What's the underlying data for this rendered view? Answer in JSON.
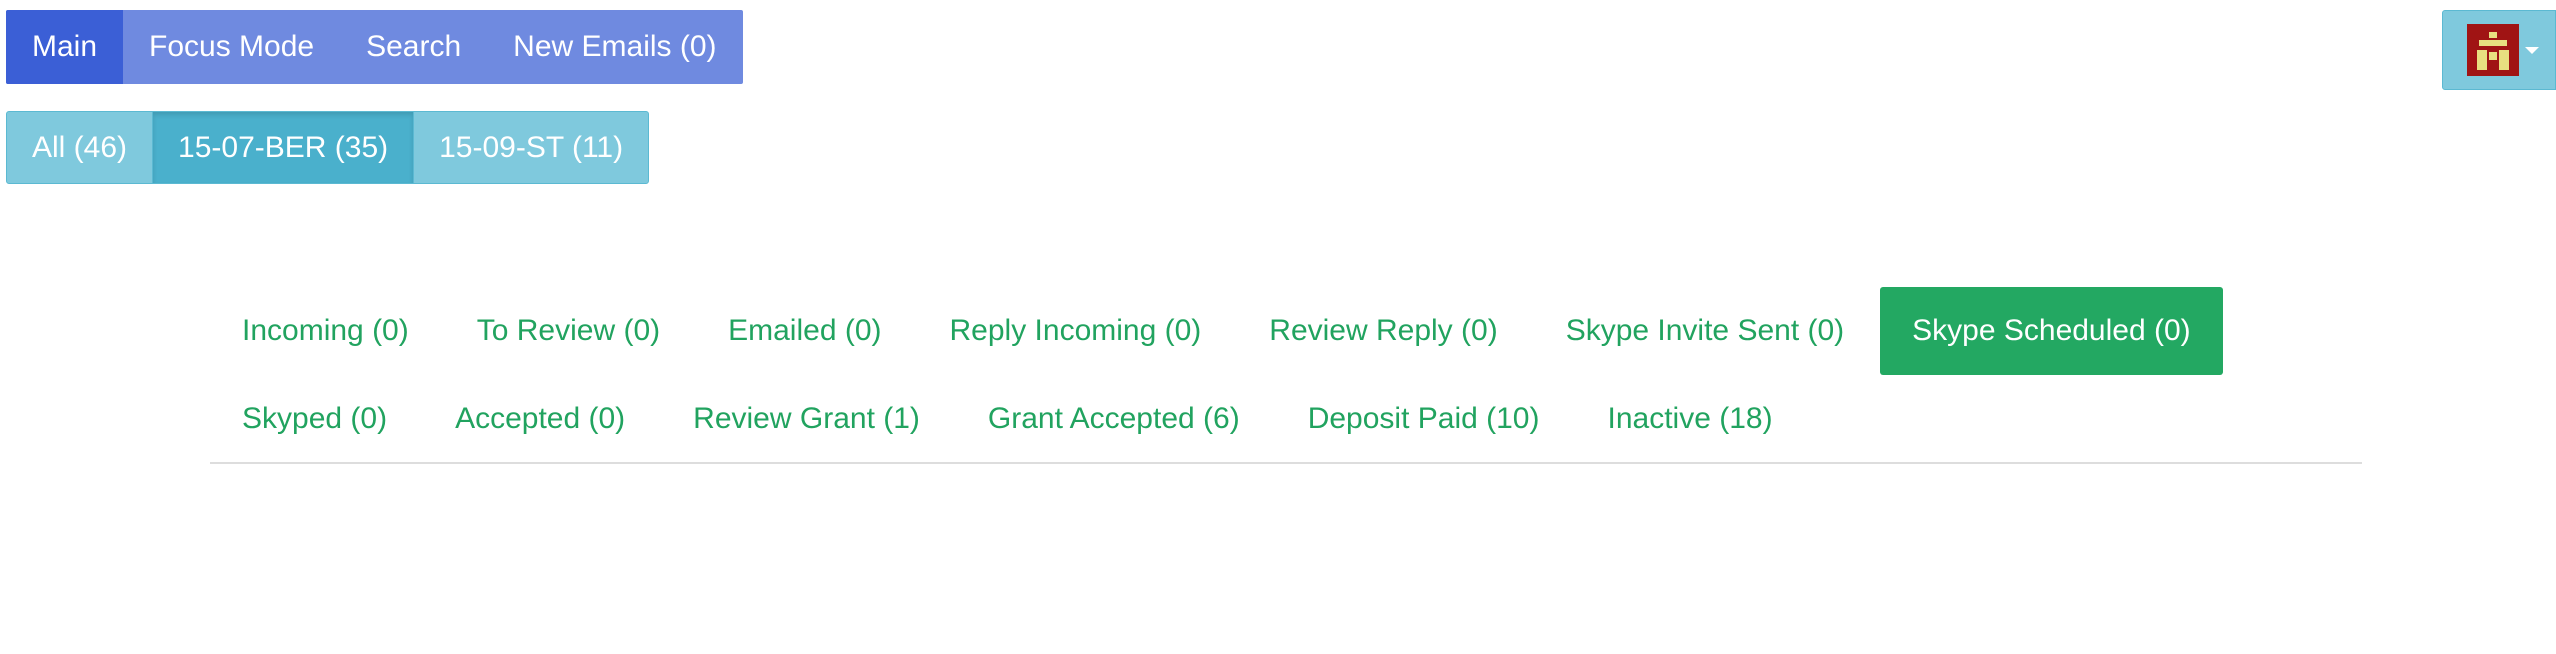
{
  "topnav": {
    "items": [
      {
        "label": "Main",
        "active": true
      },
      {
        "label": "Focus Mode",
        "active": false
      },
      {
        "label": "Search",
        "active": false
      },
      {
        "label": "New Emails (0)",
        "active": false
      }
    ]
  },
  "projects": {
    "items": [
      {
        "label": "All (46)",
        "active": false
      },
      {
        "label": "15-07-BER (35)",
        "active": true
      },
      {
        "label": "15-09-ST (11)",
        "active": false
      }
    ]
  },
  "user_menu": {
    "avatar_icon": "building-avatar-icon",
    "caret_icon": "caret-down-icon"
  },
  "status_tabs": {
    "row1": [
      {
        "label": "Incoming (0)",
        "active": false
      },
      {
        "label": "To Review (0)",
        "active": false
      },
      {
        "label": "Emailed (0)",
        "active": false
      },
      {
        "label": "Reply Incoming (0)",
        "active": false
      },
      {
        "label": "Review Reply (0)",
        "active": false
      },
      {
        "label": "Skype Invite Sent (0)",
        "active": false
      },
      {
        "label": "Skype Scheduled (0)",
        "active": true
      }
    ],
    "row2": [
      {
        "label": "Skyped (0)",
        "active": false
      },
      {
        "label": "Accepted (0)",
        "active": false
      },
      {
        "label": "Review Grant (1)",
        "active": false
      },
      {
        "label": "Grant Accepted (6)",
        "active": false
      },
      {
        "label": "Deposit Paid (10)",
        "active": false
      },
      {
        "label": "Inactive (18)",
        "active": false
      }
    ]
  },
  "colors": {
    "nav_bg": "#6f8ae0",
    "nav_active": "#3b5fd6",
    "project_bg": "#7fc9dd",
    "project_active": "#4ab0cc",
    "tab_text": "#21a35f",
    "tab_active_bg": "#23a862",
    "avatar_bg": "#a01414",
    "avatar_fg": "#e8e080"
  }
}
